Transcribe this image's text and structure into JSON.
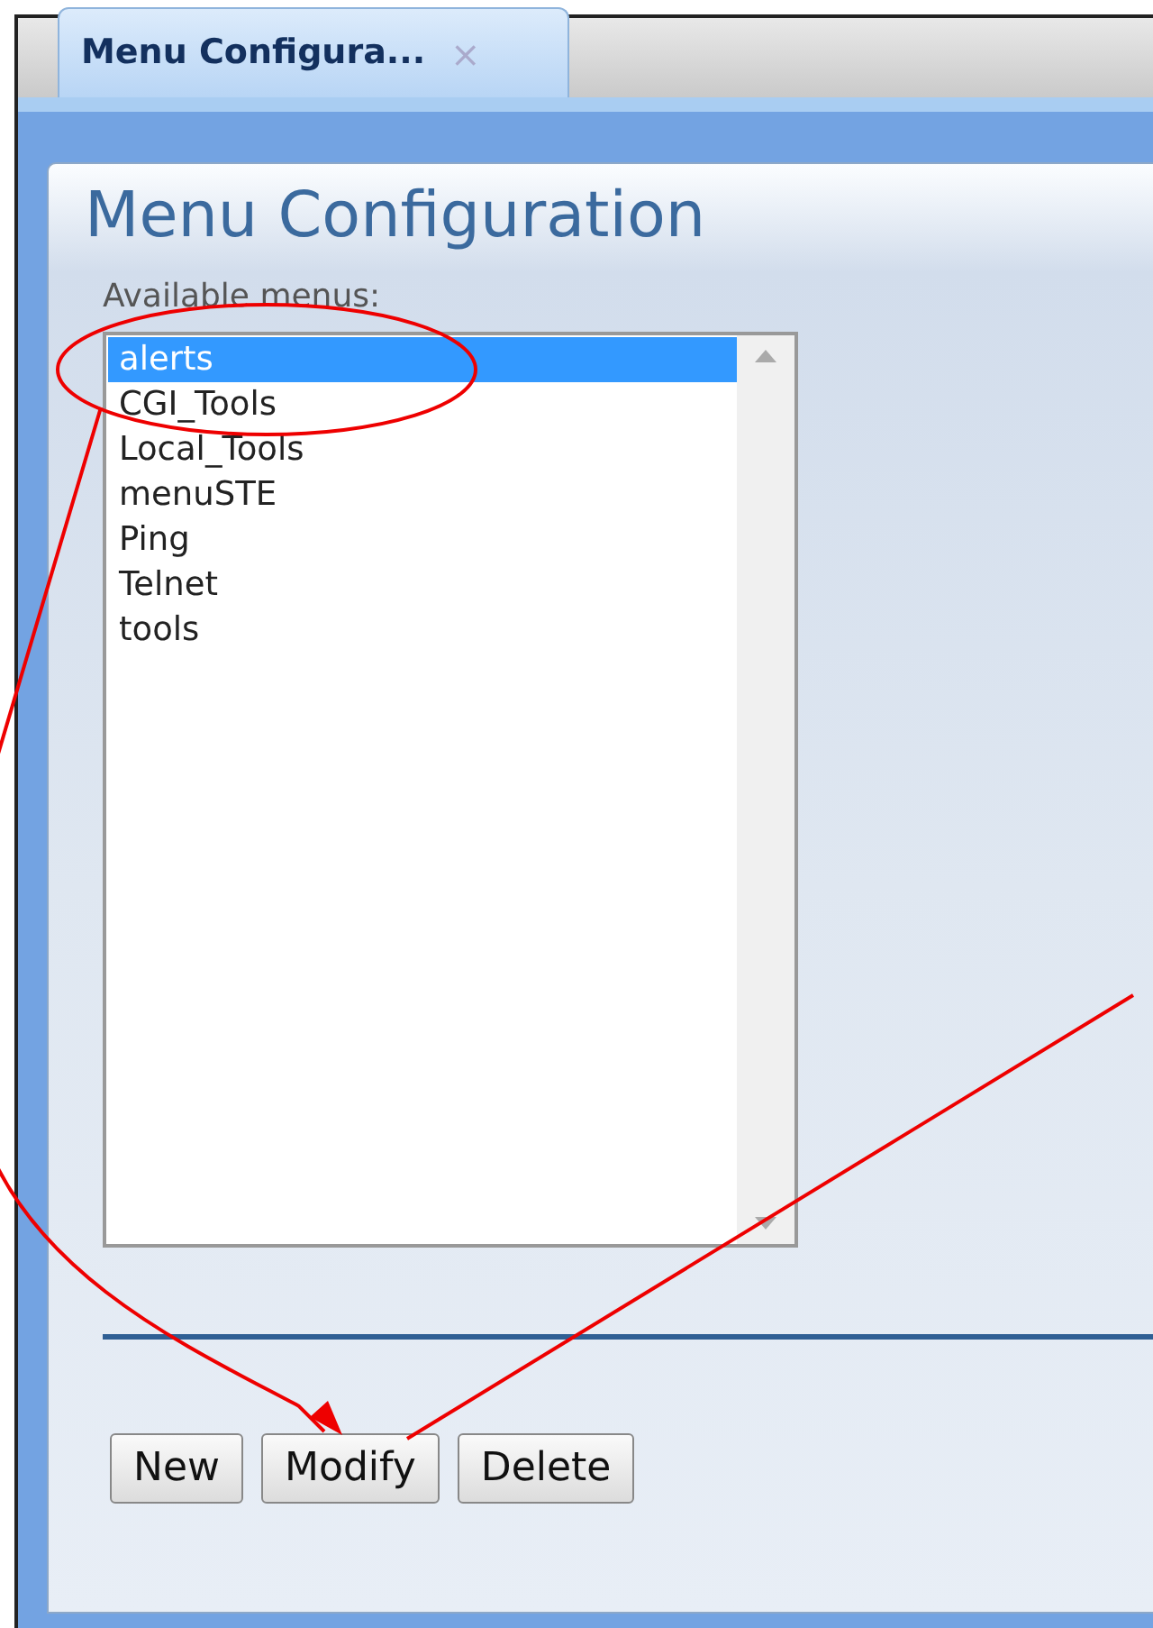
{
  "tabs": [
    {
      "label": "Menu  Configura...",
      "close": "×",
      "selected": true
    }
  ],
  "panel": {
    "title": "Menu  Configuration",
    "list_label": "Available menus:",
    "items": [
      {
        "label": "alerts",
        "selected": true
      },
      {
        "label": "CGI_Tools",
        "selected": false
      },
      {
        "label": "Local_Tools",
        "selected": false
      },
      {
        "label": "menuSTE",
        "selected": false
      },
      {
        "label": "Ping",
        "selected": false
      },
      {
        "label": "Telnet",
        "selected": false
      },
      {
        "label": "tools",
        "selected": false
      }
    ],
    "buttons": [
      "New",
      "Modify",
      "Delete"
    ]
  }
}
